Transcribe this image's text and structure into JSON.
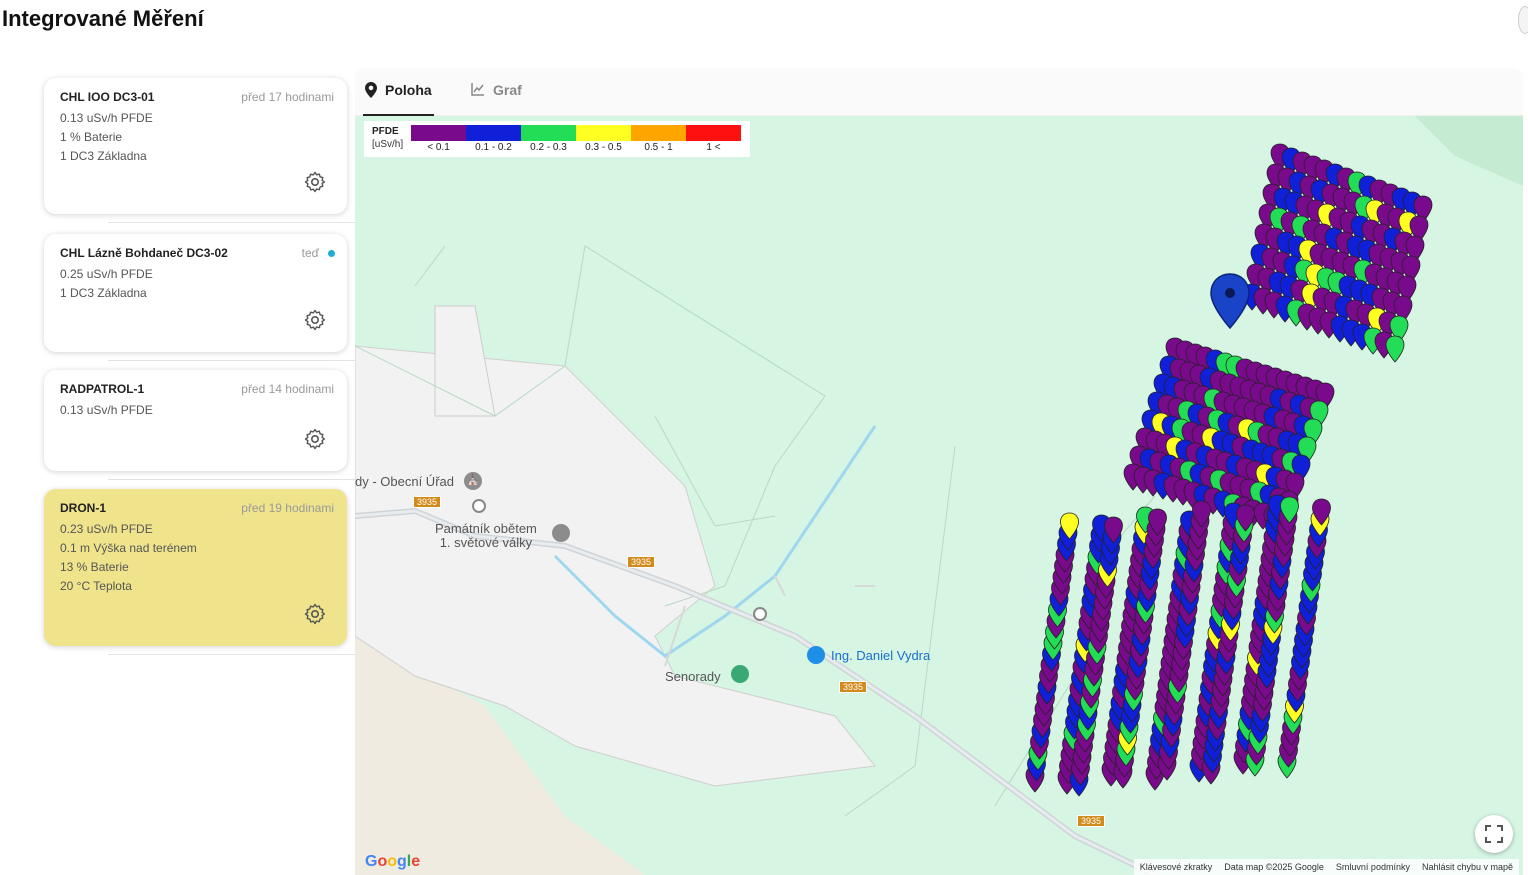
{
  "page": {
    "title": "Integrované Měření"
  },
  "devices": [
    {
      "name": "CHL IOO DC3-01",
      "time": "před 17 hodinami",
      "live": false,
      "lines": [
        "0.13 uSv/h PFDE",
        "1 % Baterie",
        "1 DC3 Základna"
      ],
      "active": false
    },
    {
      "name": "CHL Lázně Bohdaneč DC3-02",
      "time": "teď",
      "live": true,
      "lines": [
        "0.25 uSv/h PFDE",
        "1 DC3 Základna"
      ],
      "active": false
    },
    {
      "name": "RADPATROL-1",
      "time": "před 14 hodinami",
      "live": false,
      "lines": [
        "0.13 uSv/h PFDE"
      ],
      "active": false
    },
    {
      "name": "DRON-1",
      "time": "před 19 hodinami",
      "live": false,
      "lines": [
        "0.23 uSv/h PFDE",
        "0.1 m Výška nad terénem",
        "13 % Baterie",
        "20 °C Teplota"
      ],
      "active": true
    }
  ],
  "tabs": {
    "location": "Poloha",
    "chart": "Graf"
  },
  "legend": {
    "title": "PFDE",
    "unit": "[uSv/h]",
    "bins": [
      {
        "label": "< 0.1",
        "color": "#7a0a8c"
      },
      {
        "label": "0.1 - 0.2",
        "color": "#1020d8"
      },
      {
        "label": "0.2 - 0.3",
        "color": "#22dd55"
      },
      {
        "label": "0.3 - 0.5",
        "color": "#ffff22"
      },
      {
        "label": "0.5 - 1",
        "color": "#ffa500"
      },
      {
        "label": "1 <",
        "color": "#ff1010"
      }
    ]
  },
  "map": {
    "labels": {
      "office": "dy - Obecní Úřad",
      "memorial_1": "Památník obětem",
      "memorial_2": "1. světové války",
      "village": "Senorady",
      "business": "Ing. Daniel Vydra"
    },
    "road_number": "3935",
    "footer": [
      "Klávesové zkratky",
      "Data map ©2025 Google",
      "Smluvní podmínky",
      "Nahlásit chybu v mapě"
    ],
    "google": "Google"
  },
  "colors": {
    "active_card": "#efe48c",
    "live_dot": "#1aaed1",
    "map_bg": "#d6f5e3"
  }
}
